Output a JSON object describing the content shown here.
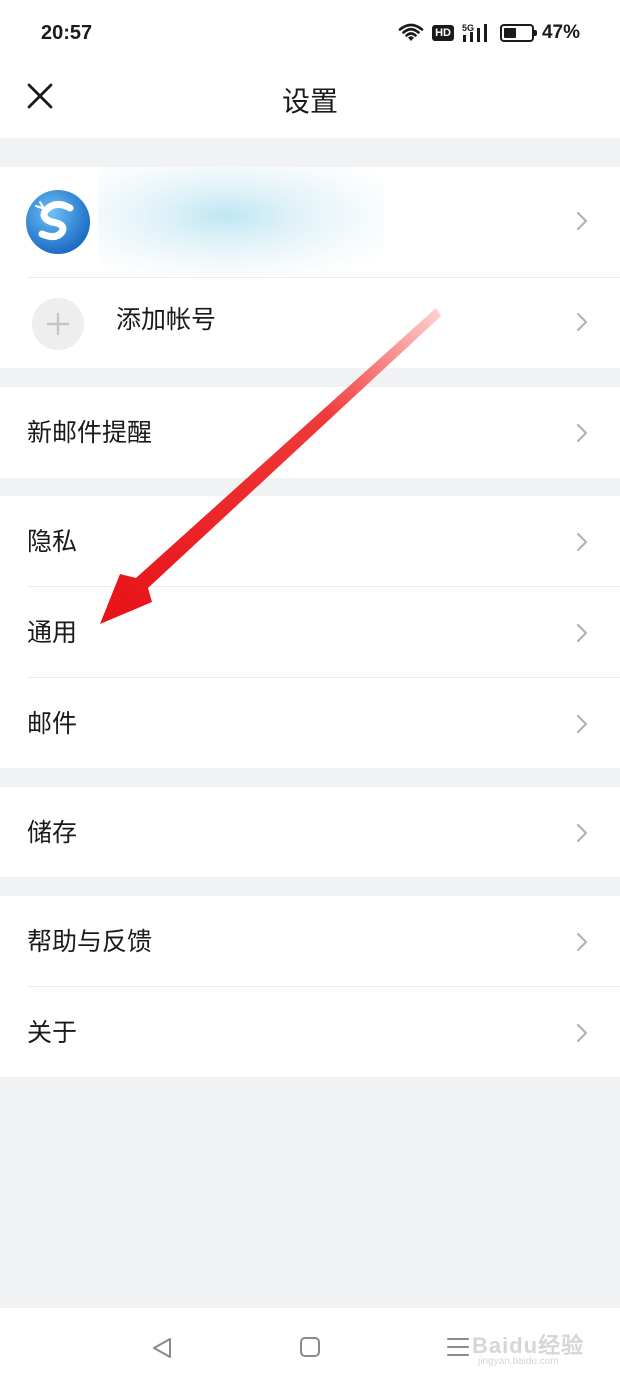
{
  "status_bar": {
    "time": "20:57",
    "hd_badge": "HD",
    "network": "5G",
    "battery_percent": "47%",
    "battery_level": 0.47,
    "icons": [
      "wifi-icon",
      "hd-icon",
      "5g-signal-icon",
      "battery-icon"
    ]
  },
  "nav": {
    "title": "设置",
    "close_icon": "close-icon"
  },
  "account": {
    "avatar_icon": "app-logo-avatar-icon",
    "add_account_label": "添加帐号",
    "add_icon": "plus-icon"
  },
  "menu": {
    "new_mail_alert": "新邮件提醒",
    "privacy": "隐私",
    "general": "通用",
    "mail": "邮件",
    "storage": "储存",
    "help_feedback": "帮助与反馈",
    "about": "关于"
  },
  "system_nav": {
    "icons": [
      "back-icon",
      "home-icon",
      "recents-icon"
    ]
  },
  "watermark": {
    "brand": "Baidu经验",
    "url": "jingyan.baidu.com"
  },
  "annotation": {
    "arrow_color": "#e8141a"
  },
  "colors": {
    "background": "#f1f2f4",
    "text": "#1a1a1a",
    "chevron": "#b3b3b3",
    "accent_blue": "#1e88e5"
  }
}
